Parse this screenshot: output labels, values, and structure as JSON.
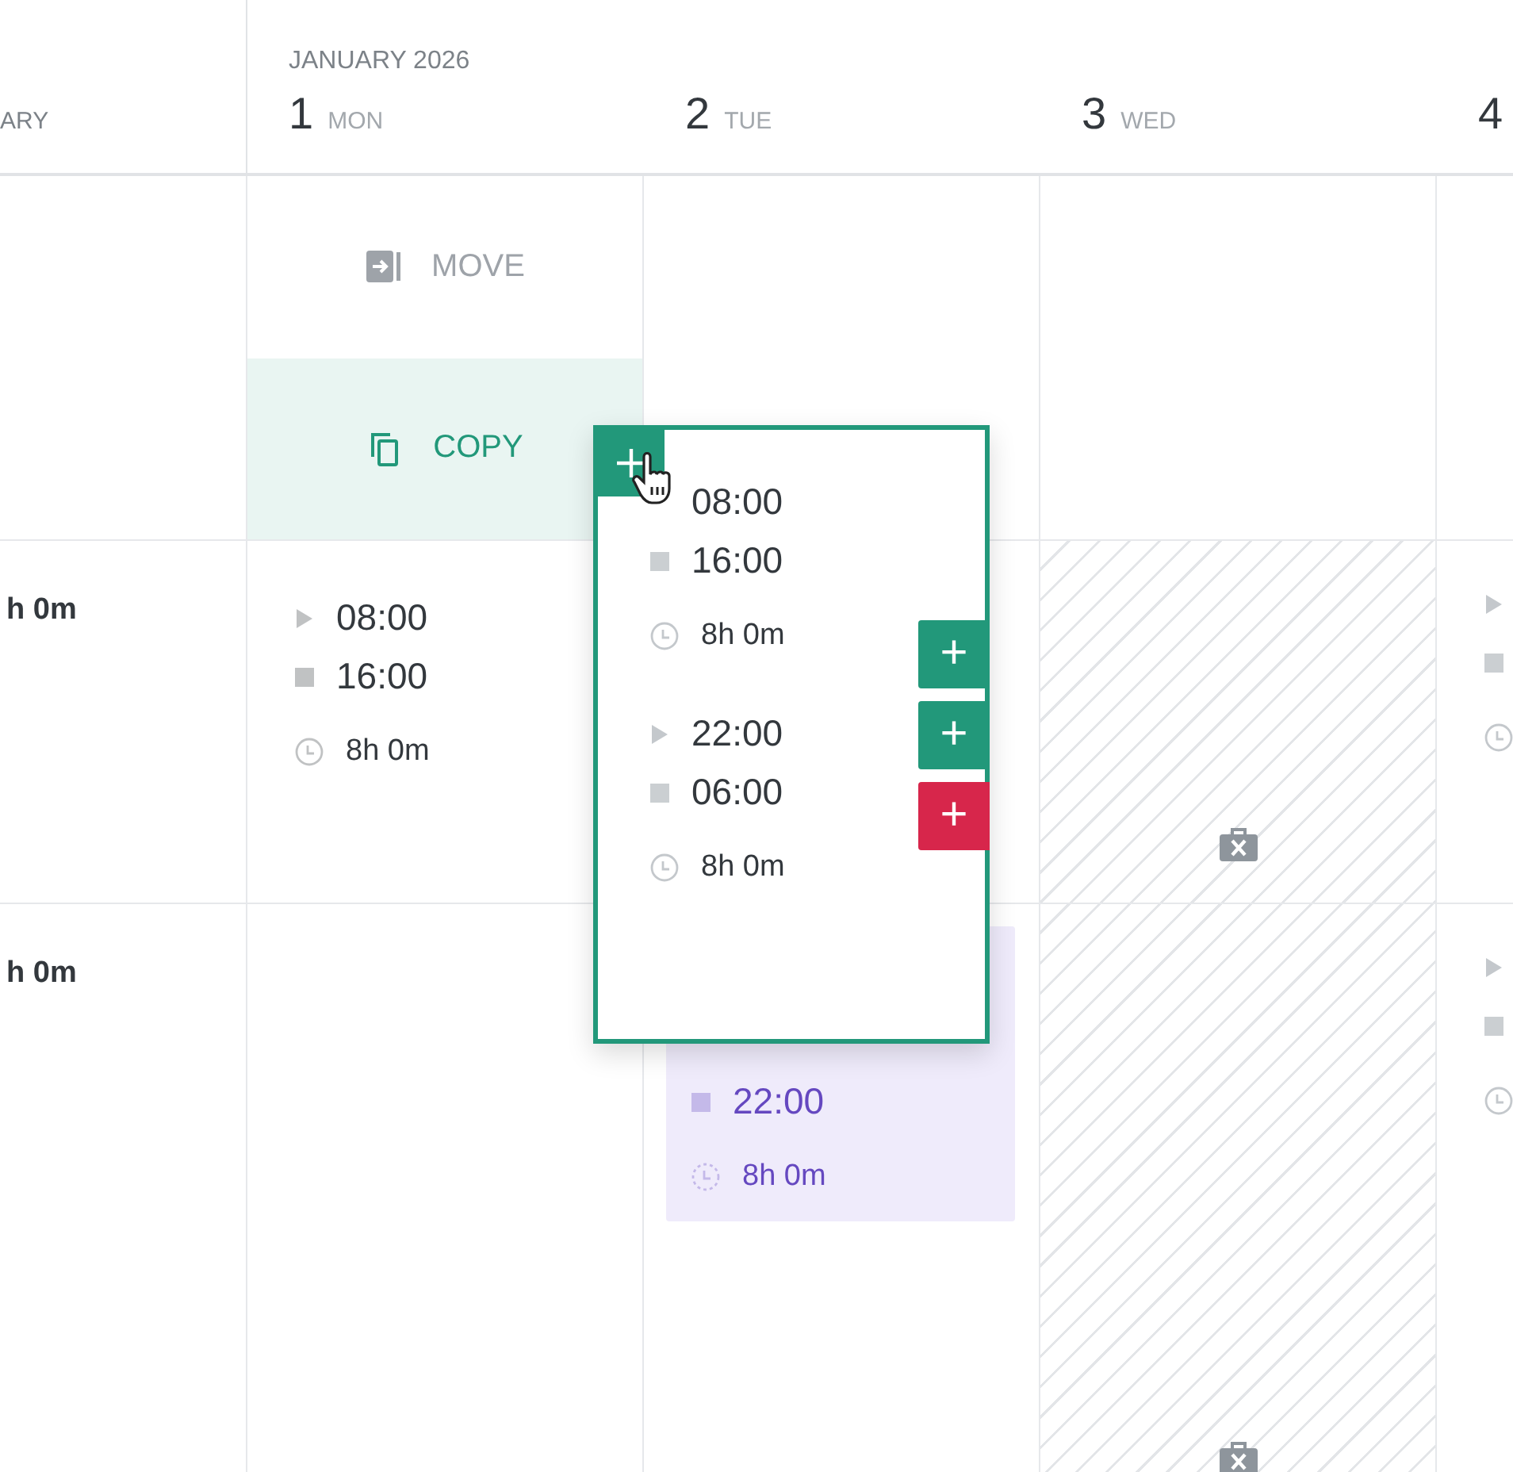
{
  "header": {
    "side_label": "ARY",
    "month": "JANUARY 2026",
    "days": [
      {
        "number": "1",
        "weekday": "MON"
      },
      {
        "number": "2",
        "weekday": "TUE"
      },
      {
        "number": "3",
        "weekday": "WED"
      },
      {
        "number": "4"
      }
    ]
  },
  "rows": [
    {
      "cells": [
        {
          "kind": "actions",
          "actions": [
            {
              "kind": "move",
              "label": "MOVE",
              "selected": false
            },
            {
              "kind": "copy",
              "label": "COPY",
              "selected": true
            }
          ]
        },
        {
          "kind": "empty"
        },
        {
          "kind": "empty"
        },
        {
          "kind": "empty"
        }
      ]
    },
    {
      "total": "h 0m",
      "cells": [
        {
          "kind": "shift",
          "start": "08:00",
          "end": "16:00",
          "duration": "8h 0m",
          "color": "#33383d"
        },
        {
          "kind": "empty"
        },
        {
          "kind": "off"
        },
        {
          "kind": "cut"
        }
      ]
    },
    {
      "total": "h 0m",
      "cells": [
        {
          "kind": "empty"
        },
        {
          "kind": "pending",
          "end": "22:00",
          "duration": "8h 0m",
          "color": "#6548c0"
        },
        {
          "kind": "off"
        },
        {
          "kind": "cut"
        }
      ]
    }
  ],
  "popover": {
    "shifts": [
      {
        "start": "08:00",
        "end": "16:00",
        "duration": "8h 0m"
      },
      {
        "start": "22:00",
        "end": "06:00",
        "duration": "8h 0m"
      }
    ],
    "buttons": [
      {
        "symbol": "+",
        "color": "#22987a"
      },
      {
        "symbol": "+",
        "color": "#22987a"
      },
      {
        "symbol": "+",
        "color": "#d7264b"
      }
    ]
  }
}
